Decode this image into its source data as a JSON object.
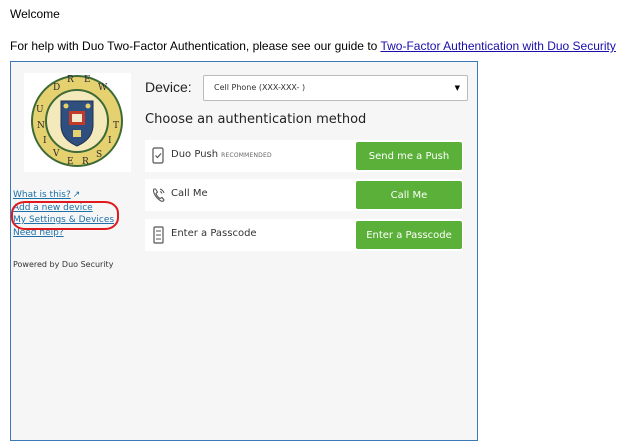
{
  "page": {
    "welcome": "Welcome",
    "help_prefix": "For help with Duo Two-Factor Authentication, please see our guide to ",
    "help_link": "Two-Factor Authentication with Duo Security"
  },
  "logo": {
    "top_letters": [
      "D",
      "R",
      "E",
      "W"
    ],
    "side_letters": [
      "U",
      "N",
      "I",
      "V",
      "E",
      "R",
      "S",
      "I",
      "T"
    ]
  },
  "sidebar": {
    "links": [
      {
        "label": "What is this?"
      },
      {
        "label": "Add a new device"
      },
      {
        "label": "My Settings & Devices"
      },
      {
        "label": "Need help?"
      }
    ],
    "powered_by": "Powered by Duo Security"
  },
  "device": {
    "label": "Device:",
    "selected": "Cell Phone (XXX-XXX-       )"
  },
  "auth": {
    "heading": "Choose an authentication method",
    "methods": [
      {
        "label": "Duo Push",
        "tag": "RECOMMENDED",
        "button": "Send me a Push",
        "icon": "phone-check-icon"
      },
      {
        "label": "Call Me",
        "tag": "",
        "button": "Call Me",
        "icon": "phone-call-icon"
      },
      {
        "label": "Enter a Passcode",
        "tag": "",
        "button": "Enter a Passcode",
        "icon": "passcode-icon"
      }
    ]
  },
  "colors": {
    "accent_green": "#5ab038",
    "link_blue": "#1d6fa8",
    "frame_border": "#3a7ab8",
    "annotation_red": "#e0191c"
  }
}
